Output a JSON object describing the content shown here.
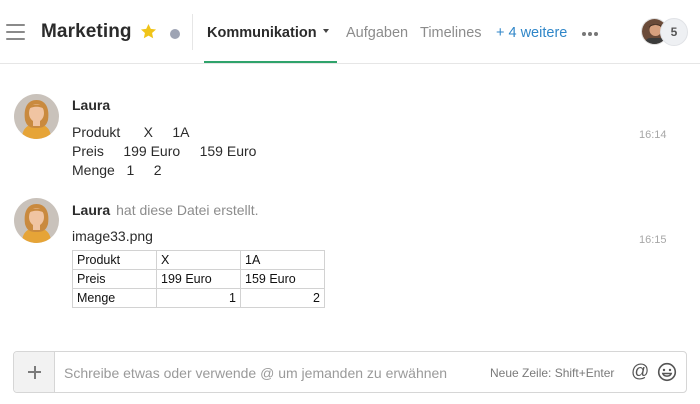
{
  "header": {
    "title": "Marketing",
    "tabs": [
      {
        "label": "Kommunikation",
        "active": true
      },
      {
        "label": "Aufgaben",
        "active": false
      },
      {
        "label": "Timelines",
        "active": false
      }
    ],
    "more_tabs_label": "+ 4 weitere",
    "member_count": "5",
    "colors": {
      "accent": "#2fa36b",
      "link": "#2f86c8",
      "star": "#f0c419"
    }
  },
  "messages": [
    {
      "author": "Laura",
      "lines": [
        "Produkt      X     1A",
        "Preis     199 Euro     159 Euro",
        "Menge   1     2"
      ],
      "time": "16:14"
    },
    {
      "author": "Laura",
      "note": "hat diese Datei erstellt.",
      "filename": "image33.png",
      "time": "16:15",
      "table": [
        [
          "Produkt",
          "X",
          "1A"
        ],
        [
          "Preis",
          "199 Euro",
          "159 Euro"
        ],
        [
          "Menge",
          "1",
          "2"
        ]
      ]
    }
  ],
  "composer": {
    "placeholder": "Schreibe etwas oder verwende @ um jemanden zu erwähnen",
    "hint": "Neue Zeile: Shift+Enter",
    "at_symbol": "@"
  },
  "icons": [
    "menu-icon",
    "star-icon",
    "status-dot-icon",
    "chevron-down-icon",
    "more-icon",
    "plus-icon",
    "at-icon",
    "emoji-icon"
  ]
}
